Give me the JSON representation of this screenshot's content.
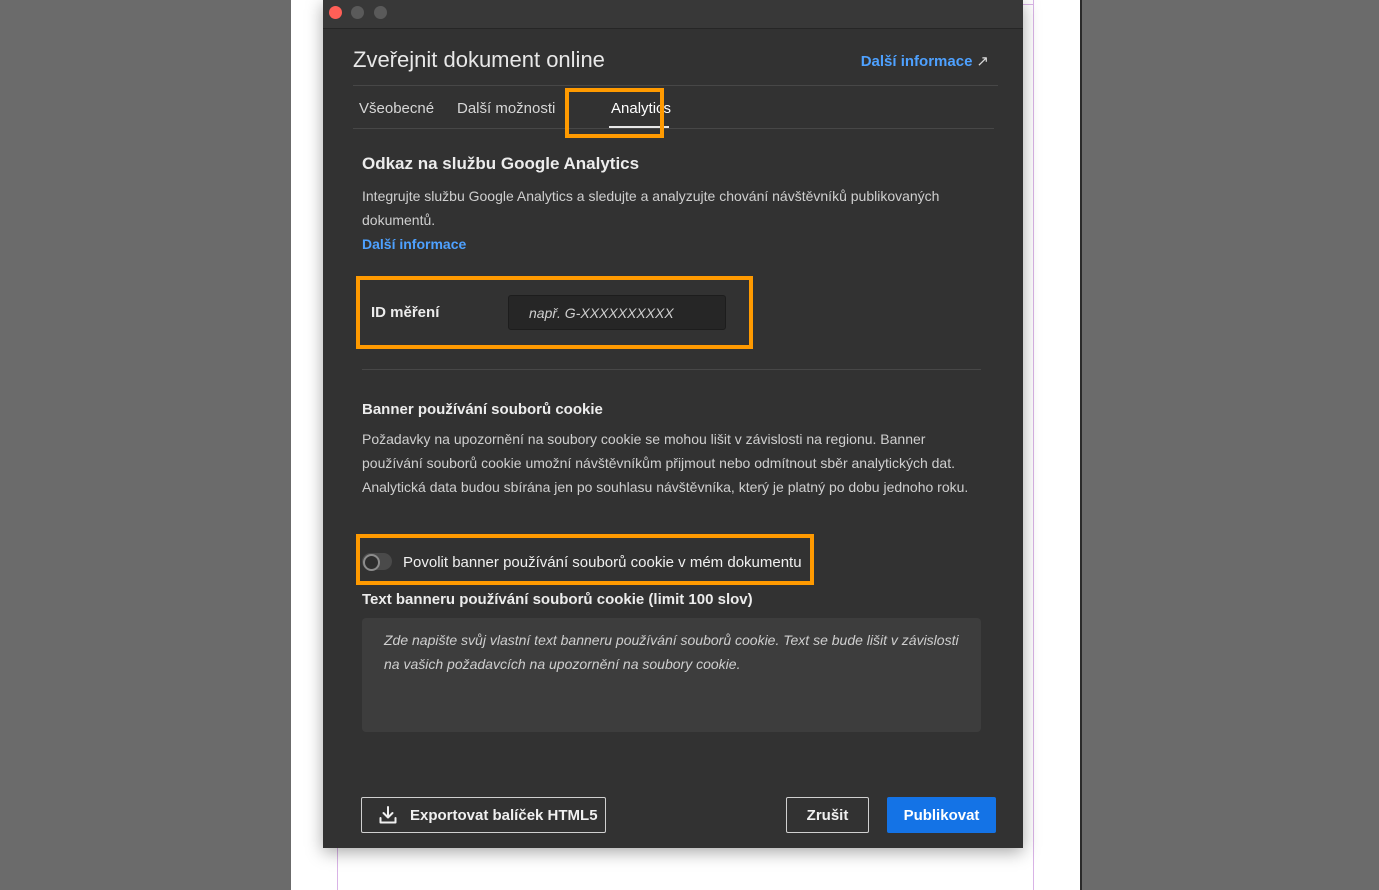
{
  "dialog": {
    "title": "Zveřejnit dokument online",
    "learn_more": "Další informace",
    "learn_more_icon": "external-link-arrow-icon"
  },
  "tabs": [
    {
      "label": "Všeobecné",
      "active": false
    },
    {
      "label": "Další možnosti",
      "active": false
    },
    {
      "label": "Analytics",
      "active": true
    }
  ],
  "analytics": {
    "title": "Odkaz na službu Google Analytics",
    "description": "Integrujte službu Google Analytics a sledujte a analyzujte chování návštěvníků publikovaných dokumentů.",
    "learn_more": "Další informace",
    "measurement_label": "ID měření",
    "measurement_value": "",
    "measurement_placeholder": "např. G-XXXXXXXXXX"
  },
  "cookie": {
    "title": "Banner používání souborů cookie",
    "description": "Požadavky na upozornění na soubory cookie se mohou lišit v závislosti na regionu. Banner používání souborů cookie umožní návštěvníkům přijmout nebo odmítnout sběr analytických dat. Analytická data budou sbírána jen po souhlasu návštěvníka, který je platný po dobu jednoho roku.",
    "toggle_label": "Povolit banner používání souborů cookie v mém dokumentu",
    "toggle_on": false,
    "banner_text_label": "Text banneru používání souborů cookie (limit 100 slov)",
    "banner_text_value": "",
    "banner_text_placeholder": "Zde napište svůj vlastní text banneru používání souborů cookie. Text se bude lišit v závislosti na vašich požadavcích na upozornění na soubory cookie."
  },
  "footer": {
    "export_label": "Exportovat balíček HTML5",
    "export_icon": "download-icon",
    "cancel_label": "Zrušit",
    "publish_label": "Publikovat"
  },
  "colors": {
    "accent": "#1473e6",
    "link": "#4ea1ff",
    "highlight": "#ff9a00",
    "dialog_bg": "#323232"
  }
}
